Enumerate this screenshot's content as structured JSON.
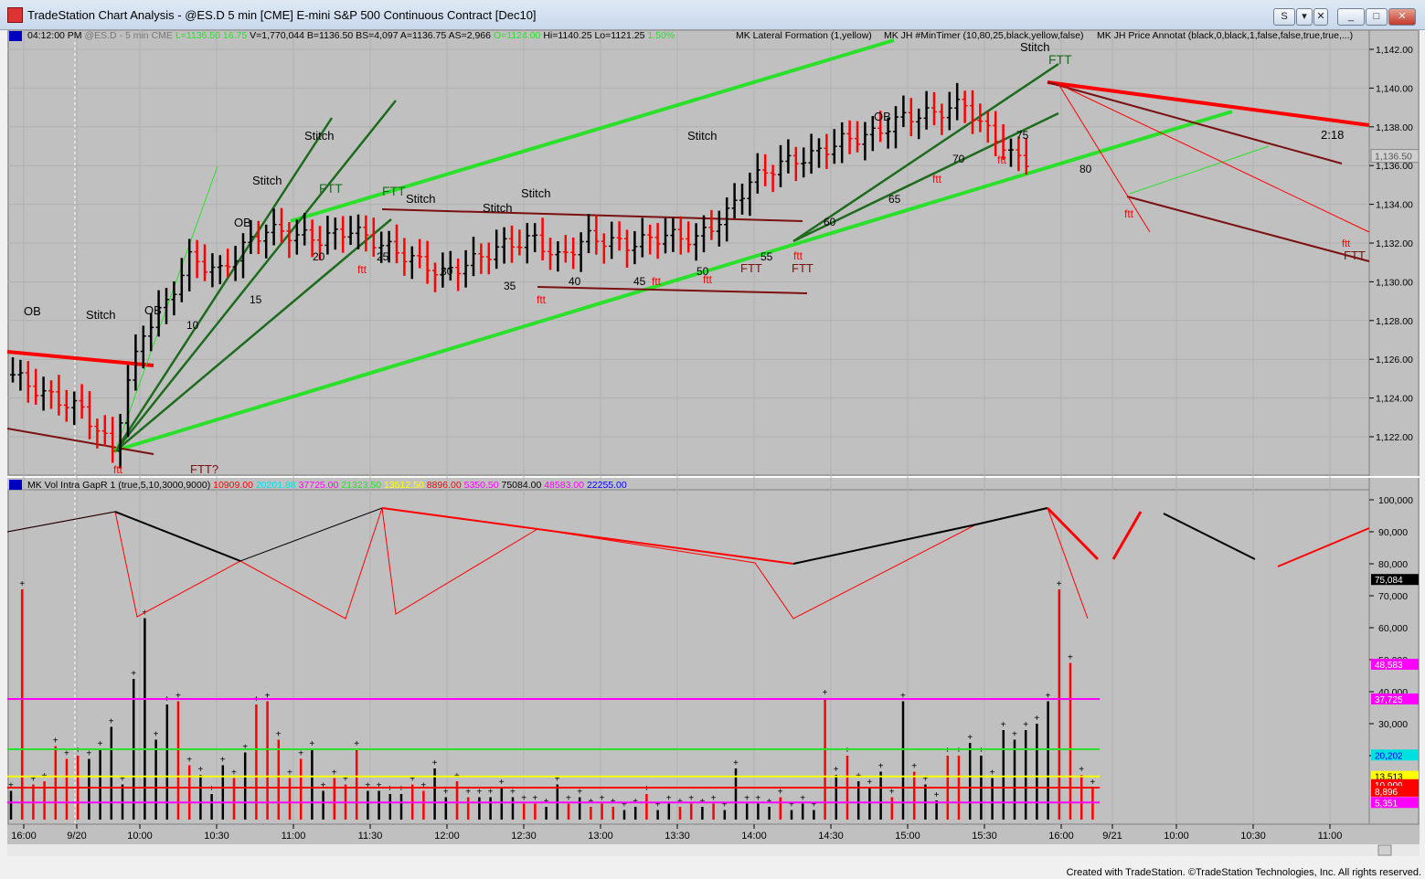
{
  "window": {
    "title": "TradeStation Chart Analysis - @ES.D 5 min [CME] E-mini S&P 500 Continuous Contract [Dec10]",
    "btn_restore": "S",
    "btn_min": "_",
    "btn_max": "□",
    "btn_close": "✕",
    "btn_tile": "▾",
    "btn_x": "✕"
  },
  "header": {
    "time": "04:12:00 PM",
    "symbol": "@ES.D - 5 min",
    "exchange": "CME",
    "last": "L=1136.50",
    "change": "16.75",
    "volume": "V=1,770,044",
    "bid": "B=1136.50",
    "bidsize": "BS=4,097",
    "ask": "A=1136.75",
    "asksize": "AS=2,966",
    "open": "O=1124.00",
    "high": "Hi=1140.25",
    "low": "Lo=1121.25",
    "pct": "1.50%",
    "ind1": "MK Lateral Formation (1,yellow)",
    "ind2": "MK JH #MinTimer (10,80,25,black,yellow,false)",
    "ind3": "MK JH Price Annotat (black,0,black,1,false,false,true,true,...)"
  },
  "vol_header": {
    "name": "MK Vol Intra GapR 1 (true,5,10,3000,9000)",
    "v1": "10909.00",
    "v2": "20201.88",
    "v3": "37725.00",
    "v4": "21323.50",
    "v5": "13512.50",
    "v6": "8896.00",
    "v7": "5350.50",
    "v8": "75084.00",
    "v9": "48583.00",
    "v10": "22255.00"
  },
  "colors": {
    "bg": "#c0c0c0",
    "up": "#000000",
    "down": "#ff0000",
    "lime": "#2be02b",
    "darkgreen": "#1e6b1e",
    "maroon": "#7a1010",
    "yellow": "#ffff00",
    "magenta": "#ff00ff"
  },
  "chart_data": [
    {
      "type": "line",
      "name": "price",
      "ylim": [
        1120,
        1143
      ],
      "yticks": [
        "1,142.00",
        "1,140.00",
        "1,138.00",
        "1,136.00",
        "1,134.00",
        "1,132.00",
        "1,130.00",
        "1,128.00",
        "1,126.00",
        "1,124.00",
        "1,122.00"
      ],
      "ytick_values": [
        1142,
        1140,
        1138,
        1136,
        1134,
        1132,
        1130,
        1128,
        1126,
        1124,
        1122
      ],
      "last_price_label": "1,136.50",
      "xticks": [
        "16:00",
        "9/20",
        "10:00",
        "10:30",
        "11:00",
        "11:30",
        "12:00",
        "12:30",
        "13:00",
        "13:30",
        "14:00",
        "14:30",
        "15:00",
        "15:30",
        "16:00",
        "9/21",
        "10:00",
        "10:30",
        "11:00"
      ],
      "close_path": [
        [
          0,
          1125.2
        ],
        [
          4,
          1124.2
        ],
        [
          9,
          1123.4
        ],
        [
          13,
          1121.3
        ],
        [
          15,
          1124.8
        ],
        [
          17,
          1127.4
        ],
        [
          20,
          1128.9
        ],
        [
          23,
          1131.2
        ],
        [
          27,
          1130.5
        ],
        [
          30,
          1131.8
        ],
        [
          33,
          1132.7
        ],
        [
          37,
          1132.4
        ],
        [
          40,
          1132.2
        ],
        [
          44,
          1132.7
        ],
        [
          48,
          1131.9
        ],
        [
          52,
          1131.2
        ],
        [
          56,
          1130.4
        ],
        [
          60,
          1131.1
        ],
        [
          64,
          1131.9
        ],
        [
          68,
          1132.2
        ],
        [
          71,
          1131.2
        ],
        [
          75,
          1132.3
        ],
        [
          80,
          1131.9
        ],
        [
          85,
          1132.4
        ],
        [
          89,
          1132.2
        ],
        [
          93,
          1133.5
        ],
        [
          96,
          1135.2
        ],
        [
          100,
          1136.1
        ],
        [
          104,
          1136.5
        ],
        [
          108,
          1137.3
        ],
        [
          112,
          1137.6
        ],
        [
          116,
          1138.5
        ],
        [
          120,
          1138.7
        ],
        [
          124,
          1139.2
        ],
        [
          126,
          1138.1
        ],
        [
          128,
          1137.5
        ],
        [
          130,
          1136.5
        ],
        [
          132,
          1136.3
        ]
      ],
      "labels": [
        "OB",
        "Stitch",
        "OB",
        "10",
        "15",
        "Stitch",
        "OB",
        "Stitch",
        "FTT",
        "20",
        "ftt",
        "FTT",
        "Stitch",
        "25",
        "30",
        "Stitch",
        "35",
        "Stitch",
        "ftt",
        "40",
        "45",
        "ftt",
        "50",
        "Stitch",
        "ftt",
        "FTT",
        "55",
        "FTT",
        "ftt",
        "60",
        "OB",
        "65",
        "ftt",
        "70",
        "ftt",
        "75",
        "Stitch",
        "FTT",
        "80",
        "ftt",
        "2:18",
        "ftt",
        "FTT",
        "ftt",
        "FTT?"
      ]
    },
    {
      "type": "bar",
      "name": "volume",
      "ylim": [
        0,
        105000
      ],
      "yticks": [
        "100,000",
        "90,000",
        "80,000",
        "70,000",
        "60,000",
        "50,000",
        "40,000",
        "30,000",
        "20,000"
      ],
      "ytick_values": [
        100000,
        90000,
        80000,
        70000,
        60000,
        50000,
        40000,
        30000,
        20000
      ],
      "labels_right": [
        "75,084",
        "48,583",
        "37,725",
        "20,202",
        "13,513",
        "10,909",
        "8,896",
        "5,351"
      ],
      "label_values": [
        75084,
        48583,
        37725,
        20202,
        13513,
        10909,
        8896,
        5351
      ],
      "ref_lines": {
        "magenta_high": 37725,
        "green": 22000,
        "yellow": 13500,
        "red_low": 10000,
        "magenta_low": 5350
      },
      "volumes": [
        9000,
        72000,
        11000,
        12000,
        23000,
        19000,
        20000,
        19000,
        22000,
        29000,
        11000,
        44000,
        63000,
        25000,
        36000,
        37000,
        17000,
        14000,
        8000,
        17000,
        13000,
        21000,
        36000,
        37000,
        25000,
        13000,
        19000,
        22000,
        9000,
        13000,
        11000,
        22000,
        9000,
        9000,
        8000,
        8000,
        11000,
        9000,
        16000,
        7000,
        12000,
        7000,
        7000,
        7000,
        10000,
        7000,
        5000,
        5000,
        4000,
        11000,
        5000,
        7000,
        4000,
        5000,
        4000,
        3000,
        4000,
        8000,
        3000,
        5000,
        4000,
        5000,
        4000,
        5000,
        3000,
        16000,
        5000,
        5000,
        4000,
        7000,
        3000,
        5000,
        3000,
        38000,
        14000,
        20000,
        12000,
        10000,
        15000,
        7000,
        37000,
        15000,
        11000,
        6000,
        20000,
        20000,
        24000,
        20000,
        13000,
        28000,
        25000,
        28000,
        30000,
        37000,
        72000,
        49000,
        14000,
        10000
      ],
      "dir": [
        1,
        -1,
        -1,
        -1,
        -1,
        -1,
        -1,
        1,
        1,
        1,
        1,
        1,
        1,
        1,
        1,
        -1,
        -1,
        1,
        1,
        1,
        -1,
        1,
        -1,
        -1,
        -1,
        -1,
        -1,
        1,
        1,
        -1,
        -1,
        -1,
        1,
        1,
        1,
        1,
        -1,
        -1,
        1,
        1,
        -1,
        -1,
        1,
        1,
        1,
        1,
        -1,
        -1,
        1,
        1,
        -1,
        1,
        -1,
        -1,
        -1,
        1,
        1,
        -1,
        1,
        1,
        -1,
        -1,
        1,
        -1,
        1,
        1,
        1,
        1,
        1,
        -1,
        1,
        1,
        1,
        -1,
        1,
        -1,
        1,
        1,
        1,
        -1,
        1,
        -1,
        1,
        1,
        -1,
        -1,
        1,
        1,
        1,
        1,
        1,
        1,
        1,
        1,
        -1,
        -1,
        -1,
        -1
      ]
    }
  ],
  "footer": {
    "credit": "Created with TradeStation. ©TradeStation Technologies, Inc. All rights reserved."
  }
}
